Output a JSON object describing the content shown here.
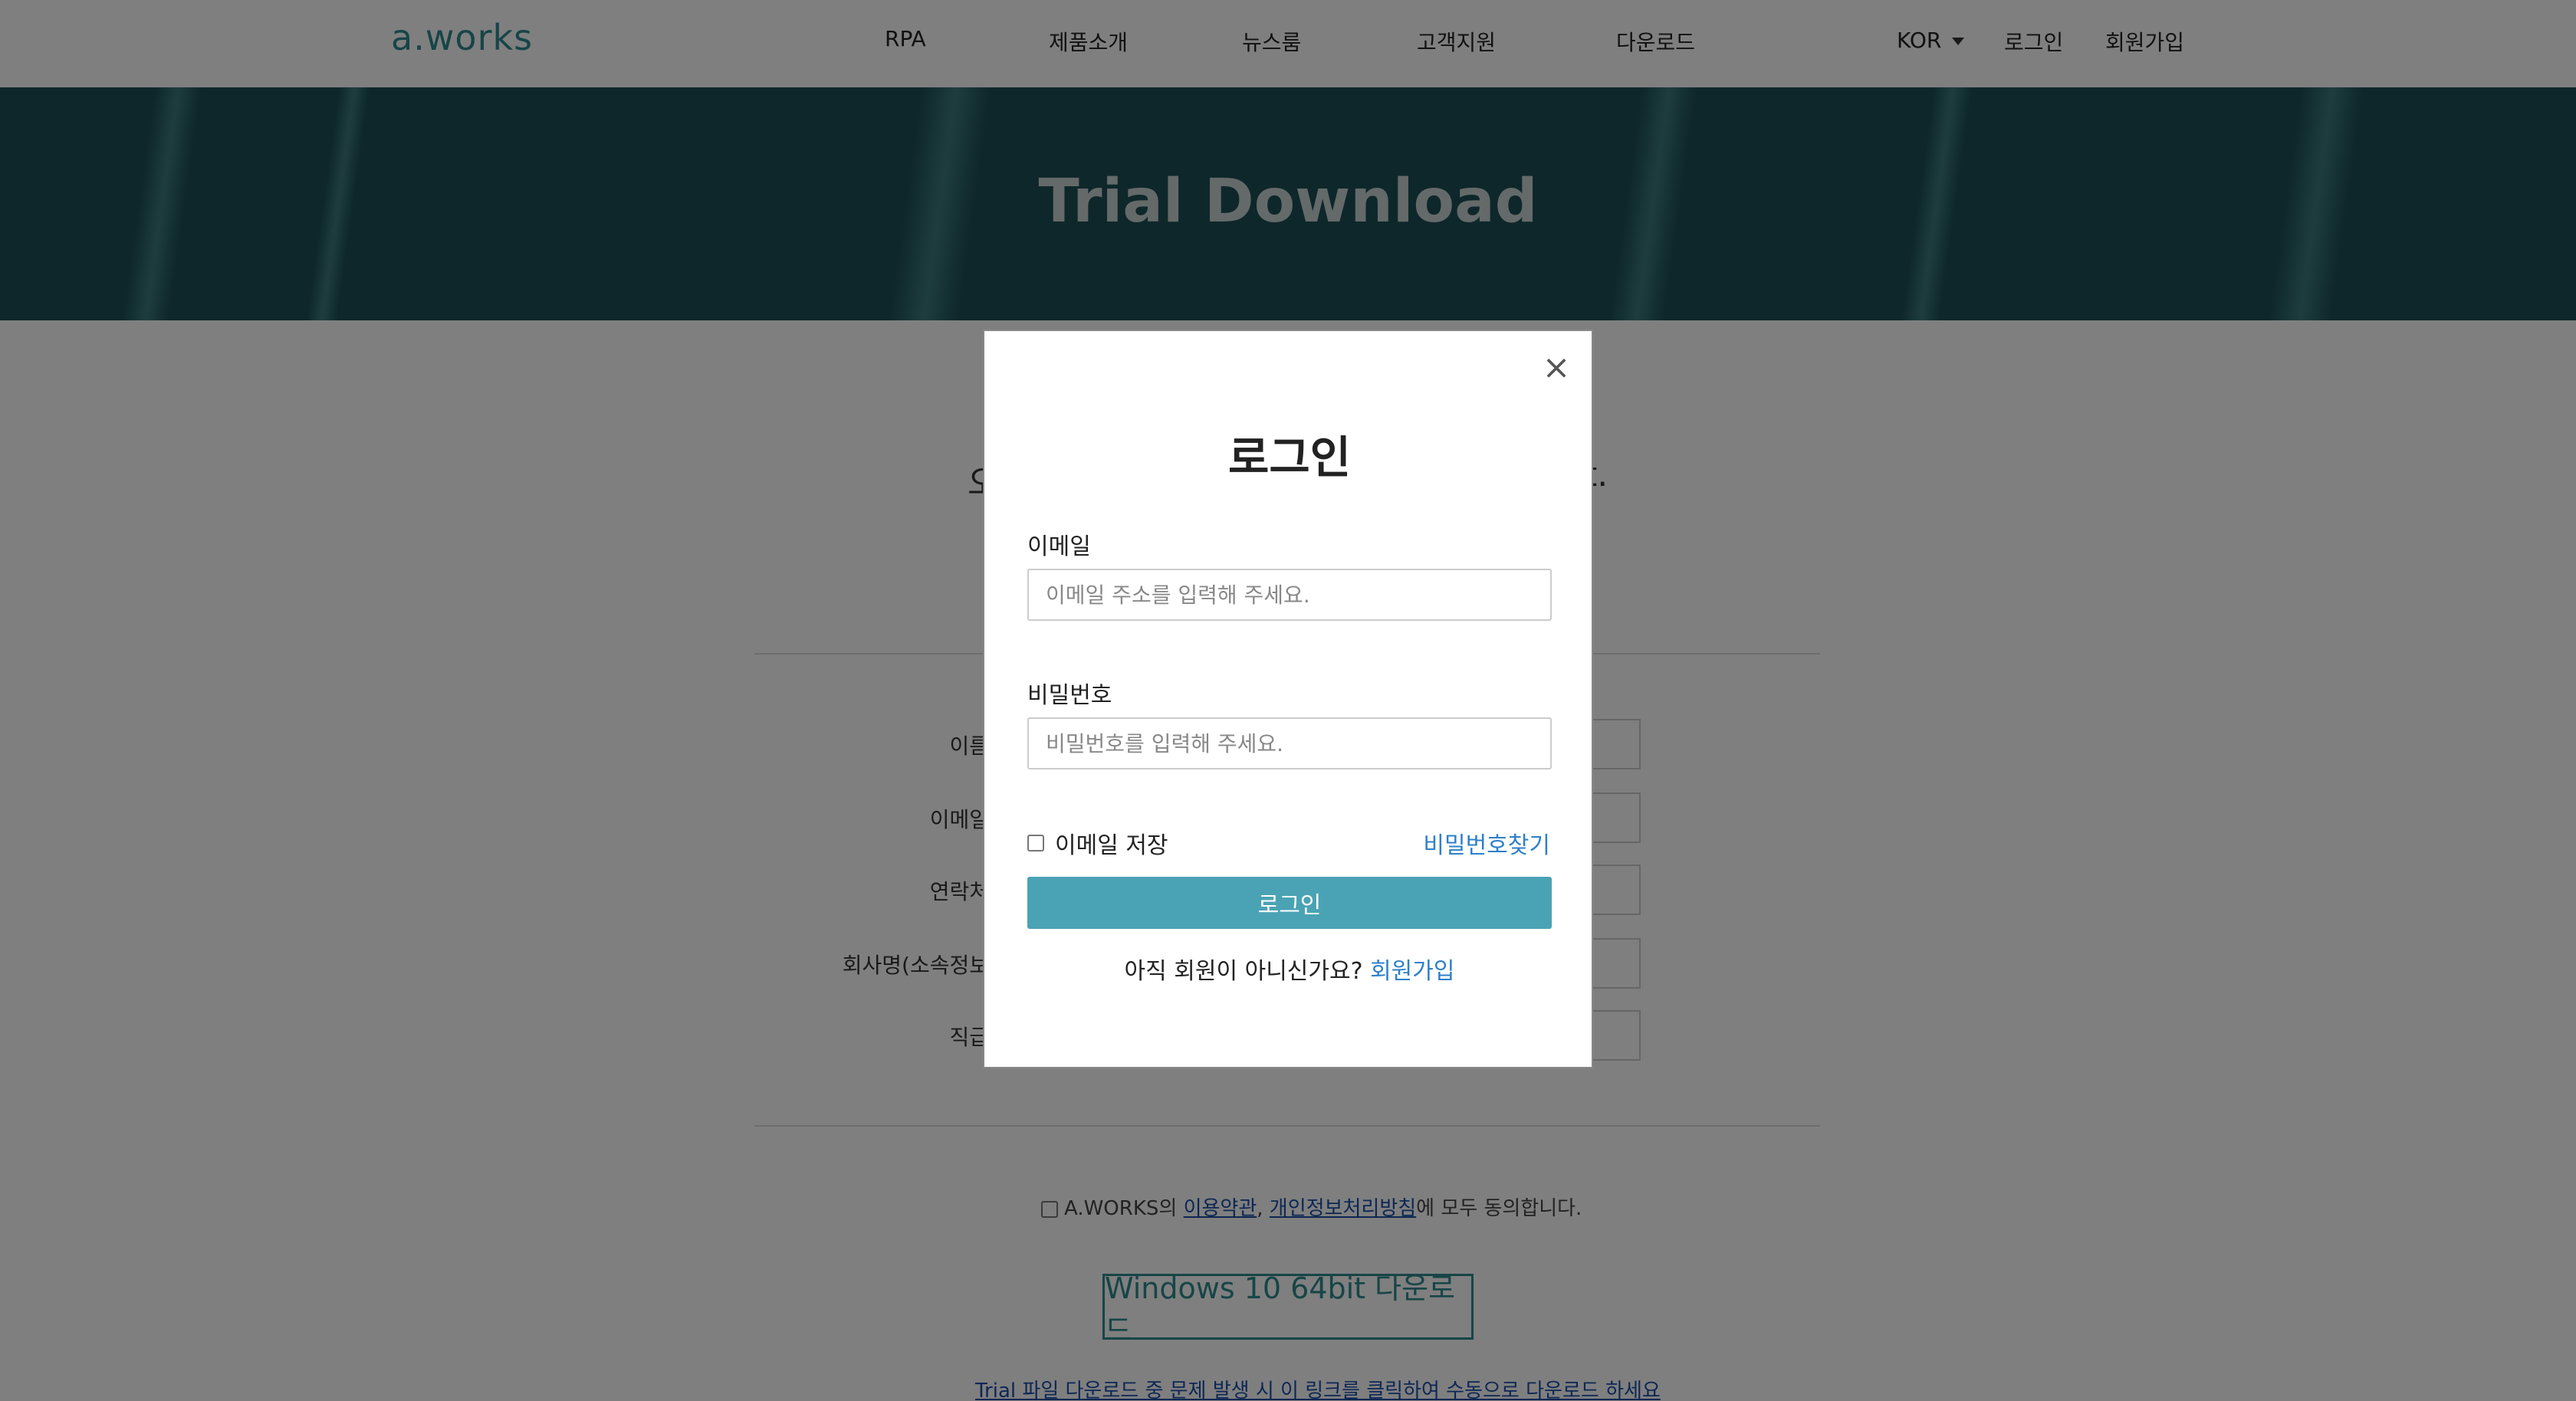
{
  "navbar": {
    "logo": "a.works",
    "menu": [
      "RPA",
      "제품소개",
      "뉴스룸",
      "고객지원",
      "다운로드"
    ],
    "lang": "KOR",
    "login": "로그인",
    "signup": "회원가입"
  },
  "hero": {
    "title": "Trial Download"
  },
  "background_form": {
    "intro_start": "오",
    "intro_end": "t.",
    "labels": [
      "이름",
      "이메일",
      "연락처",
      "회사명(소속정보",
      "직급"
    ],
    "agree": {
      "prefix": "A.WORKS의 ",
      "terms": "이용약관",
      "comma": ", ",
      "privacy": "개인정보처리방침",
      "suffix": "에 모두 동의합니다."
    },
    "download_button": "Windows 10 64bit 다운로드",
    "manual_link": "Trial 파일 다운로드 중 문제 발생 시 이 링크를 클릭하여 수동으로 다운로드 하세요"
  },
  "modal": {
    "title": "로그인",
    "close_icon": "×",
    "email_label": "이메일",
    "email_placeholder": "이메일 주소를 입력해 주세요.",
    "password_label": "비밀번호",
    "password_placeholder": "비밀번호를 입력해 주세요.",
    "remember_label": "이메일 저장",
    "find_password": "비밀번호찾기",
    "login_button": "로그인",
    "signup_prompt": "아직 회원이 아니신가요?",
    "signup_link": "회원가입"
  },
  "colors": {
    "brand": "#2e8a8e",
    "hero_bg": "#1d4f55",
    "login_button": "#4aa3b4",
    "link": "#2f80c9"
  }
}
